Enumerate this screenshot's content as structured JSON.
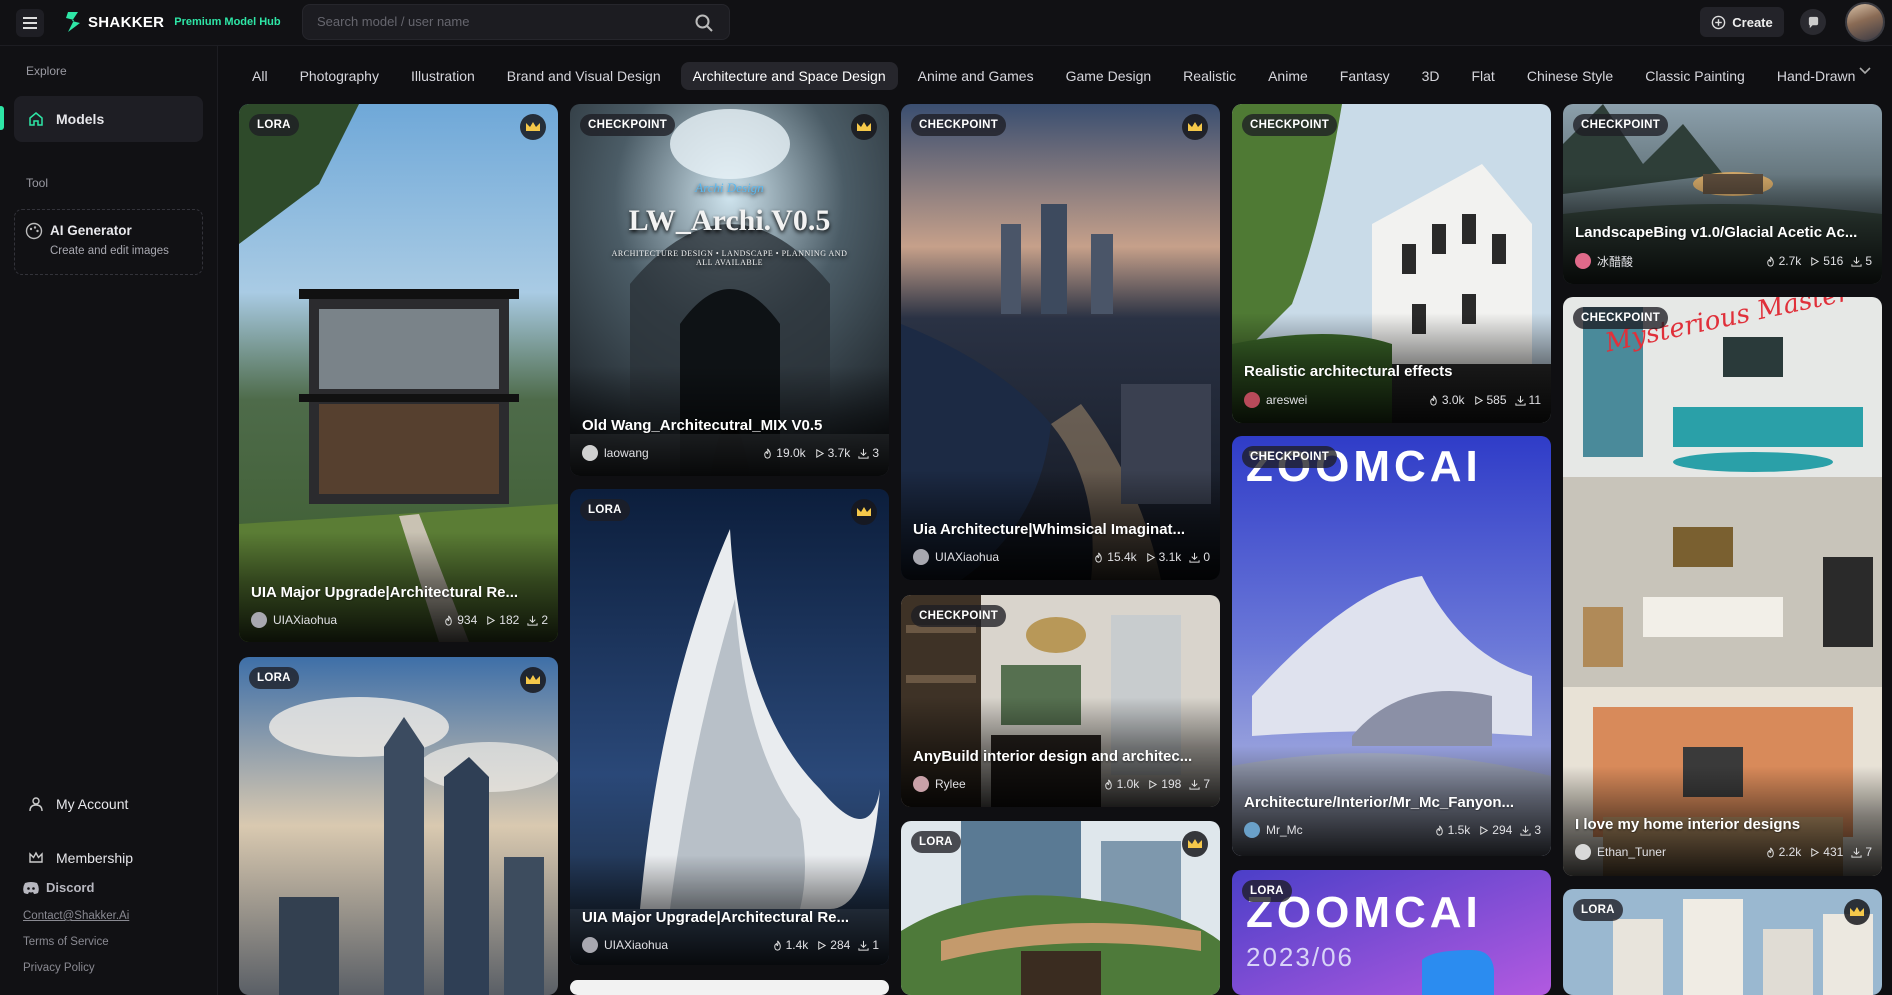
{
  "app": {
    "name": "SHAKKER",
    "tagline": "Premium Model Hub"
  },
  "search": {
    "placeholder": "Search model / user name"
  },
  "header": {
    "create_label": "Create"
  },
  "sidebar": {
    "explore_label": "Explore",
    "models_label": "Models",
    "tool_label": "Tool",
    "ai_generator_title": "AI Generator",
    "ai_generator_sub": "Create and edit images",
    "my_account": "My Account",
    "membership": "Membership",
    "discord": "Discord",
    "contact": "Contact@Shakker.Ai",
    "terms": "Terms of Service",
    "privacy": "Privacy Policy"
  },
  "categories": [
    "All",
    "Photography",
    "Illustration",
    "Brand and Visual Design",
    "Architecture and Space Design",
    "Anime and Games",
    "Game Design",
    "Realistic",
    "Anime",
    "Fantasy",
    "3D",
    "Flat",
    "Chinese Style",
    "Classic Painting",
    "Hand-Drawn"
  ],
  "active_category": "Architecture and Space Design",
  "colors": {
    "accent": "#2ee6a6",
    "bg": "#0f0f12",
    "card_badge": "#1e1e24",
    "crown": "#f5c84a"
  },
  "cards": [
    {
      "badge": "LORA",
      "title": "UIA Major Upgrade|Architectural Re...",
      "user": "UIAXiaohua",
      "likes": "934",
      "runs": "182",
      "downloads": "2"
    },
    {
      "badge": "CHECKPOINT",
      "image_text": "LW_Archi.V0.5",
      "logo_text": "Archi Design",
      "subtitle_text": "ARCHITECTURE DESIGN • LANDSCAPE • PLANNING AND ALL AVAILABLE",
      "title": "Old Wang_Architecutral_MIX V0.5",
      "user": "laowang",
      "likes": "19.0k",
      "runs": "3.7k",
      "downloads": "3"
    },
    {
      "badge": "CHECKPOINT",
      "title": "Uia Architecture|Whimsical Imaginat...",
      "user": "UIAXiaohua",
      "likes": "15.4k",
      "runs": "3.1k",
      "downloads": "0"
    },
    {
      "badge": "CHECKPOINT",
      "title": "Realistic architectural effects",
      "user": "areswei",
      "likes": "3.0k",
      "runs": "585",
      "downloads": "11"
    },
    {
      "badge": "CHECKPOINT",
      "title": "LandscapeBing v1.0/Glacial Acetic Ac...",
      "user": "冰醋酸",
      "likes": "2.7k",
      "runs": "516",
      "downloads": "5"
    },
    {
      "badge": "LORA",
      "title": "UIA Major Upgrade|Architectural Re...",
      "user": "UIAXiaohua",
      "likes": "1.4k",
      "runs": "284",
      "downloads": "1"
    },
    {
      "badge": "CHECKPOINT",
      "title": "AnyBuild interior design and architec...",
      "user": "Rylee",
      "likes": "1.0k",
      "runs": "198",
      "downloads": "7"
    },
    {
      "badge": "CHECKPOINT",
      "image_text": "ZOOMCAI",
      "title": "Architecture/Interior/Mr_Mc_Fanyon...",
      "user": "Mr_Mc",
      "likes": "1.5k",
      "runs": "294",
      "downloads": "3"
    },
    {
      "badge": "CHECKPOINT",
      "image_text": "Mysterious Master",
      "title": "I love my home interior designs",
      "user": "Ethan_Tuner",
      "likes": "2.2k",
      "runs": "431",
      "downloads": "7"
    },
    {
      "badge": "LORA"
    },
    {
      "badge": "LORA"
    },
    {
      "badge": "LORA",
      "image_text": "ZOOMCAI",
      "image_subtext": "2023/06"
    },
    {
      "badge": "LORA"
    }
  ]
}
